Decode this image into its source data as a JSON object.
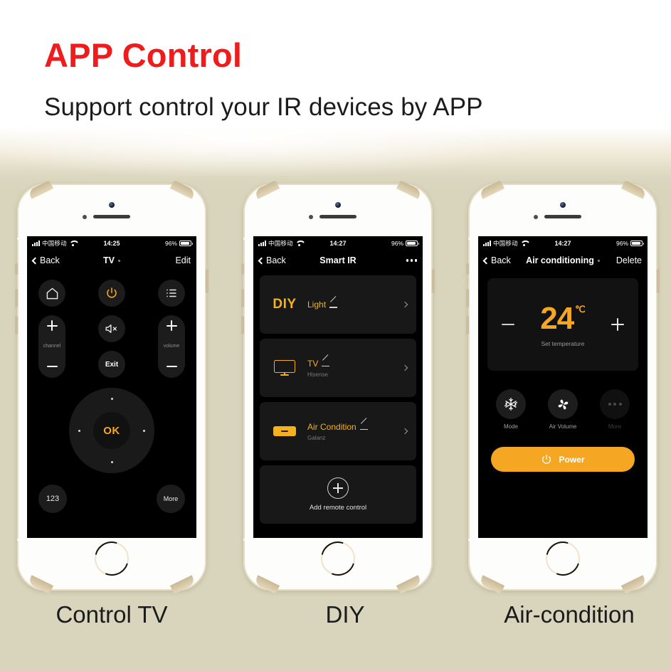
{
  "page": {
    "title": "APP Control",
    "subtitle": "Support control your IR devices by APP",
    "title_color": "#ee1c1c",
    "background_color": "#d9d5bd",
    "accent_color": "#f5a623"
  },
  "captions": {
    "phone1": "Control TV",
    "phone2": "DIY",
    "phone3": "Air-condition"
  },
  "phone1": {
    "status": {
      "carrier": "中国移动",
      "time": "14:25",
      "battery": "96%"
    },
    "nav": {
      "back": "Back",
      "title": "TV",
      "right": "Edit"
    },
    "buttons": {
      "home": "home-icon",
      "power": "power-icon",
      "menu": "list-icon",
      "mute": "mute-icon",
      "exit": "Exit",
      "channel_label": "channel",
      "volume_label": "volume",
      "ok": "OK",
      "numeric": "123",
      "more": "More"
    }
  },
  "phone2": {
    "status": {
      "carrier": "中国移动",
      "time": "14:27",
      "battery": "96%"
    },
    "nav": {
      "back": "Back",
      "title": "Smart IR",
      "right": "more-options"
    },
    "devices": [
      {
        "icon_label": "DIY",
        "name": "Light",
        "brand": ""
      },
      {
        "icon_label": "tv-icon",
        "name": "TV",
        "brand": "Hisense"
      },
      {
        "icon_label": "air-conditioner-icon",
        "name": "Air Condition",
        "brand": "Galanz"
      }
    ],
    "add": {
      "label": "Add remote control"
    }
  },
  "phone3": {
    "status": {
      "carrier": "中国移动",
      "time": "14:27",
      "battery": "96%"
    },
    "nav": {
      "back": "Back",
      "title": "Air conditioning",
      "right": "Delete"
    },
    "temperature": {
      "value": "24",
      "unit": "℃",
      "caption": "Set temperature",
      "decrease": "minus",
      "increase": "plus"
    },
    "modes": [
      {
        "icon": "snowflake-icon",
        "label": "Mode"
      },
      {
        "icon": "fan-icon",
        "label": "Air Volume"
      },
      {
        "icon": "ellipsis-icon",
        "label": "More"
      }
    ],
    "power": {
      "label": "Power"
    }
  }
}
